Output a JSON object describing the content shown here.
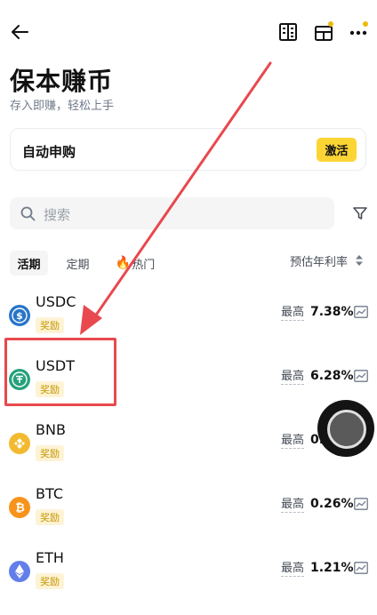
{
  "header": {
    "back_icon": "arrow-left-icon",
    "right_icons": [
      "orders-icon",
      "layout-icon",
      "more-icon"
    ]
  },
  "page": {
    "title": "保本赚币",
    "subtitle": "存入即赚，轻松上手"
  },
  "auto_subscribe": {
    "label": "自动申购",
    "button": "激活"
  },
  "search": {
    "placeholder": "搜索"
  },
  "tabs": [
    {
      "label": "活期",
      "active": true
    },
    {
      "label": "定期",
      "active": false
    },
    {
      "label": "热门",
      "active": false,
      "icon": "fire-icon"
    }
  ],
  "sort": {
    "label": "预估年利率"
  },
  "coins": [
    {
      "name": "USDC",
      "badge": "奖励",
      "max_label": "最高",
      "rate": "7.38%",
      "color": "#2775CA"
    },
    {
      "name": "USDT",
      "badge": "奖励",
      "max_label": "最高",
      "rate": "6.28%",
      "color": "#26A17B"
    },
    {
      "name": "BNB",
      "badge": "奖励",
      "max_label": "最高",
      "rate": "0.",
      "color": "#F3BA2F"
    },
    {
      "name": "BTC",
      "badge": "奖励",
      "max_label": "最高",
      "rate": "0.26%",
      "color": "#F7931A"
    },
    {
      "name": "ETH",
      "badge": "奖励",
      "max_label": "最高",
      "rate": "1.21%",
      "color": "#627EEA"
    }
  ],
  "colors": {
    "accent": "#FCD535",
    "annotation": "#E8484E"
  }
}
